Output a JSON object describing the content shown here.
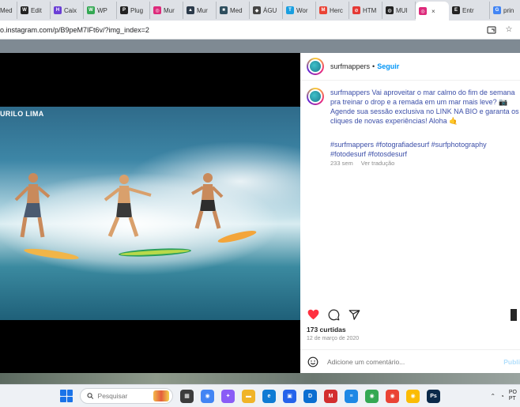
{
  "browser": {
    "tabs": [
      {
        "label": "Med",
        "favicon_color": "#1f2937",
        "favicon_glyph": "M"
      },
      {
        "label": "Edit",
        "favicon_color": "#222222",
        "favicon_glyph": "W"
      },
      {
        "label": "Caix",
        "favicon_color": "#6b3fd6",
        "favicon_glyph": "H"
      },
      {
        "label": "WP",
        "favicon_color": "#34a853",
        "favicon_glyph": "W"
      },
      {
        "label": "Plug",
        "favicon_color": "#222222",
        "favicon_glyph": "P"
      },
      {
        "label": "Mur",
        "favicon_color": "#dd2a7b",
        "favicon_glyph": "◎"
      },
      {
        "label": "Mur",
        "favicon_color": "#2b3a4a",
        "favicon_glyph": "▲"
      },
      {
        "label": "Med",
        "favicon_color": "#2e4e5e",
        "favicon_glyph": "■"
      },
      {
        "label": "ÁGU",
        "favicon_color": "#444444",
        "favicon_glyph": "◆"
      },
      {
        "label": "Wor",
        "favicon_color": "#1a9fe0",
        "favicon_glyph": "T"
      },
      {
        "label": "Herc",
        "favicon_color": "#ea4335",
        "favicon_glyph": "M"
      },
      {
        "label": "HTM",
        "favicon_color": "#e53935",
        "favicon_glyph": "⊘"
      },
      {
        "label": "MUI",
        "favicon_color": "#222222",
        "favicon_glyph": "◍"
      },
      {
        "label": "",
        "favicon_color": "#dd2a7b",
        "favicon_glyph": "◎",
        "active": true
      },
      {
        "label": "Entr",
        "favicon_color": "#222222",
        "favicon_glyph": "E"
      },
      {
        "label": "prin",
        "favicon_color": "#4285f4",
        "favicon_glyph": "G"
      }
    ],
    "close_glyph": "×",
    "url": "o.instagram.com/p/B9peM7IFt6v/?img_index=2"
  },
  "post": {
    "photo_credit": "URILO LIMA",
    "header": {
      "username": "surfmappers",
      "separator": "•",
      "follow_label": "Seguir"
    },
    "caption": {
      "username": "surfmappers",
      "text": "Vai aproveitar o mar calmo do fim de semana pra treinar o drop e a remada em um mar mais leve? 📷 Agende sua sessão exclusiva no LINK NA BIO e garanta os cliques de novas experiências! Aloha 🤙"
    },
    "hashtags": "#surfmappers #fotografiadesurf #surfphotography #fotodesurf #fotosdesurf",
    "time_ago": "233 sem",
    "translate_label": "Ver tradução",
    "likes": "173 curtidas",
    "date": "12 de março de 2020",
    "comment_placeholder": "Adicione um comentário...",
    "publish_label": "Publi",
    "icons": [
      "heart-icon",
      "comment-icon",
      "share-icon",
      "bookmark-icon",
      "emoji-icon"
    ],
    "colors": {
      "like_red": "#ff3040",
      "link_blue": "#0095f6",
      "caption_blue": "#3b4ea8"
    }
  },
  "taskbar": {
    "search_placeholder": "Pesquisar",
    "tray_text": "PO",
    "tray_text2": "PT",
    "apps": [
      {
        "name": "file-explorer",
        "color": "#3c3c3c",
        "glyph": "▦"
      },
      {
        "name": "chrome",
        "color": "#4285f4",
        "glyph": "◉"
      },
      {
        "name": "copilot",
        "color": "#8a5cf6",
        "glyph": "✦"
      },
      {
        "name": "folder",
        "color": "#f0b429",
        "glyph": "▬"
      },
      {
        "name": "edge",
        "color": "#0f7bd4",
        "glyph": "e"
      },
      {
        "name": "store",
        "color": "#2563eb",
        "glyph": "▣"
      },
      {
        "name": "dell",
        "color": "#0a6ed1",
        "glyph": "D"
      },
      {
        "name": "mcafee",
        "color": "#d32f2f",
        "glyph": "M"
      },
      {
        "name": "notes",
        "color": "#1e88e5",
        "glyph": "≡"
      },
      {
        "name": "chrome-2",
        "color": "#34a853",
        "glyph": "◉"
      },
      {
        "name": "chrome-3",
        "color": "#ea4335",
        "glyph": "◉"
      },
      {
        "name": "chrome-4",
        "color": "#fbbc05",
        "glyph": "◉"
      },
      {
        "name": "photoshop",
        "color": "#0b2a4a",
        "glyph": "Ps"
      }
    ]
  }
}
